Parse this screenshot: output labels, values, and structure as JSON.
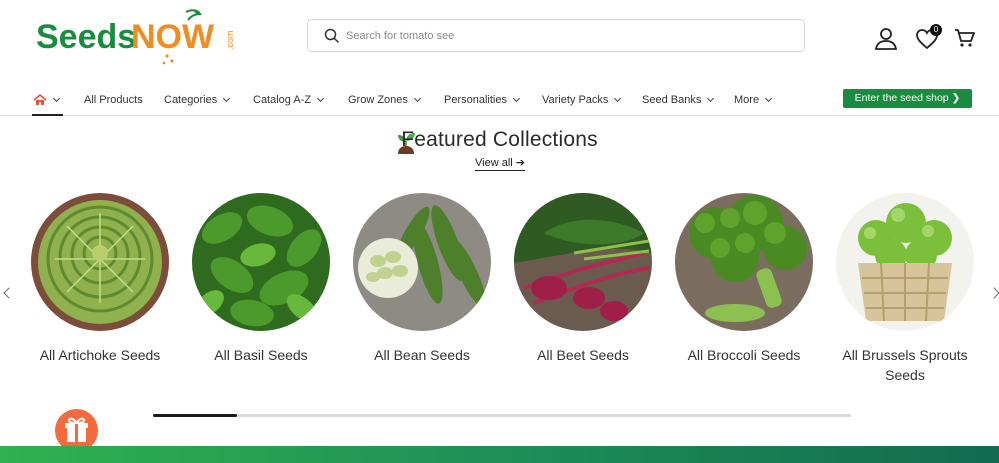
{
  "header": {
    "logo": {
      "text_seeds": "Seeds",
      "text_now": "NOW",
      "text_com": ".com"
    },
    "search": {
      "placeholder": "Search for tomato see"
    },
    "account_icon": "user-icon",
    "wishlist": {
      "icon": "heart-icon",
      "count": "0"
    },
    "cart_icon": "cart-icon"
  },
  "nav": {
    "home_icon": "home-icon",
    "items": [
      {
        "label": "All Products",
        "dropdown": false
      },
      {
        "label": "Categories",
        "dropdown": true
      },
      {
        "label": "Catalog A-Z",
        "dropdown": true
      },
      {
        "label": "Grow Zones",
        "dropdown": true
      },
      {
        "label": "Personalities",
        "dropdown": true
      },
      {
        "label": "Variety Packs",
        "dropdown": true
      },
      {
        "label": "Seed Banks",
        "dropdown": true
      },
      {
        "label": "More",
        "dropdown": true
      }
    ],
    "cta": "Enter the seed shop ❯"
  },
  "featured": {
    "title": "Featured Collections",
    "view_all": "View all ➔",
    "collections": [
      {
        "label": "All Artichoke Seeds"
      },
      {
        "label": "All Basil Seeds"
      },
      {
        "label": "All Bean Seeds"
      },
      {
        "label": "All Beet Seeds"
      },
      {
        "label": "All Broccoli Seeds"
      },
      {
        "label": "All Brussels Sprouts Seeds"
      }
    ],
    "scroll_progress": 0.12
  },
  "colors": {
    "brand_green": "#1a8c3f",
    "logo_orange": "#f28c1e",
    "gift_orange": "#f26a3d"
  }
}
